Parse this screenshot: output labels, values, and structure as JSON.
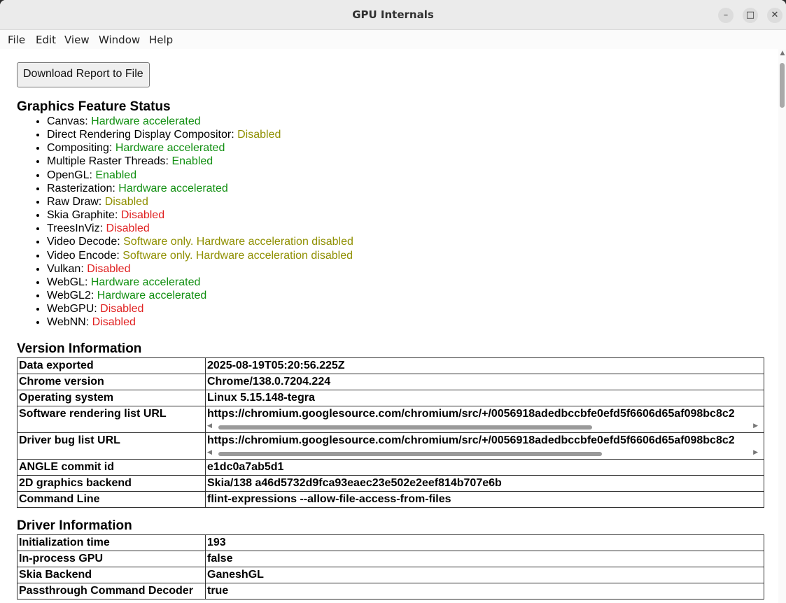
{
  "window": {
    "title": "GPU Internals",
    "controls": {
      "minimize": "–",
      "maximize": "□",
      "close": "✕"
    }
  },
  "menu": [
    "File",
    "Edit",
    "View",
    "Window",
    "Help"
  ],
  "download_button": "Download Report to File",
  "feature_status": {
    "heading": "Graphics Feature Status",
    "items": [
      {
        "name": "Canvas: ",
        "status": "Hardware accelerated",
        "color": "#118f11"
      },
      {
        "name": "Direct Rendering Display Compositor: ",
        "status": "Disabled",
        "color": "#8f8f00"
      },
      {
        "name": "Compositing: ",
        "status": "Hardware accelerated",
        "color": "#118f11"
      },
      {
        "name": "Multiple Raster Threads: ",
        "status": "Enabled",
        "color": "#118f11"
      },
      {
        "name": "OpenGL: ",
        "status": "Enabled",
        "color": "#118f11"
      },
      {
        "name": "Rasterization: ",
        "status": "Hardware accelerated",
        "color": "#118f11"
      },
      {
        "name": "Raw Draw: ",
        "status": "Disabled",
        "color": "#8f8f00"
      },
      {
        "name": "Skia Graphite: ",
        "status": "Disabled",
        "color": "#e02020"
      },
      {
        "name": "TreesInViz: ",
        "status": "Disabled",
        "color": "#e02020"
      },
      {
        "name": "Video Decode: ",
        "status": "Software only. Hardware acceleration disabled",
        "color": "#8f8f00"
      },
      {
        "name": "Video Encode: ",
        "status": "Software only. Hardware acceleration disabled",
        "color": "#8f8f00"
      },
      {
        "name": "Vulkan: ",
        "status": "Disabled",
        "color": "#e02020"
      },
      {
        "name": "WebGL: ",
        "status": "Hardware accelerated",
        "color": "#118f11"
      },
      {
        "name": "WebGL2: ",
        "status": "Hardware accelerated",
        "color": "#118f11"
      },
      {
        "name": "WebGPU: ",
        "status": "Disabled",
        "color": "#e02020"
      },
      {
        "name": "WebNN: ",
        "status": "Disabled",
        "color": "#e02020"
      }
    ]
  },
  "version_info": {
    "heading": "Version Information",
    "rows": [
      {
        "key": "Data exported",
        "value": "2025-08-19T05:20:56.225Z"
      },
      {
        "key": "Chrome version",
        "value": "Chrome/138.0.7204.224"
      },
      {
        "key": "Operating system",
        "value": "Linux 5.15.148-tegra"
      },
      {
        "key": "Software rendering list URL",
        "value": "https://chromium.googlesource.com/chromium/src/+/0056918adedbccbfe0efd5f6606d65af098bc8c2",
        "scroll": true
      },
      {
        "key": "Driver bug list URL",
        "value": "https://chromium.googlesource.com/chromium/src/+/0056918adedbccbfe0efd5f6606d65af098bc8c2",
        "scroll": true
      },
      {
        "key": "ANGLE commit id",
        "value": "e1dc0a7ab5d1"
      },
      {
        "key": "2D graphics backend",
        "value": "Skia/138 a46d5732d9fca93eaec23e502e2eef814b707e6b"
      },
      {
        "key": "Command Line",
        "value": "flint-expressions --allow-file-access-from-files"
      }
    ]
  },
  "driver_info": {
    "heading": "Driver Information",
    "rows": [
      {
        "key": "Initialization time",
        "value": "193"
      },
      {
        "key": "In-process GPU",
        "value": "false"
      },
      {
        "key": "Skia Backend",
        "value": "GaneshGL"
      },
      {
        "key": "Passthrough Command Decoder",
        "value": "true"
      }
    ]
  }
}
